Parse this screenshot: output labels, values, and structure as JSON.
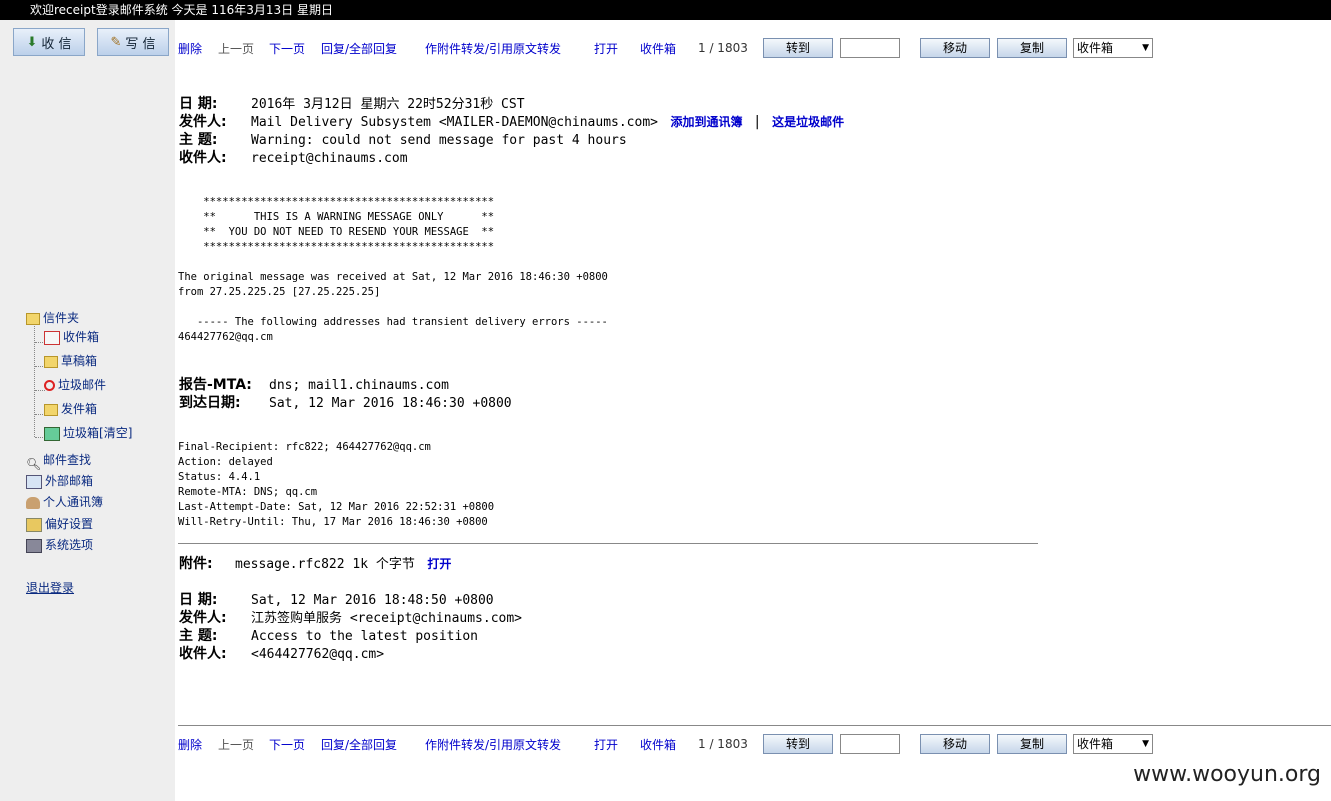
{
  "topbar": {
    "text": "欢迎receipt登录邮件系统  今天是  116年3月13日  星期日"
  },
  "sidebar": {
    "btn_receive": "收 信",
    "btn_compose": "写 信",
    "folders_label": "信件夹",
    "inbox": "收件箱",
    "drafts": "草稿箱",
    "spam": "垃圾邮件",
    "sent": "发件箱",
    "trash": "垃圾箱",
    "trash_empty": "[清空]",
    "search": "邮件查找",
    "external": "外部邮箱",
    "contacts": "个人通讯簿",
    "prefs": "偏好设置",
    "sysopts": "系统选项",
    "logout": "退出登录"
  },
  "toolbar": {
    "delete": "删除",
    "prev": "上一页",
    "next": "下一页",
    "reply": "回复/全部回复",
    "forward": "作附件转发/引用原文转发",
    "open": "打开",
    "folder_link": "收件箱",
    "pager": "1 / 1803",
    "goto": "转到",
    "move": "移动",
    "copy": "复制",
    "select_value": "收件箱"
  },
  "message": {
    "date_label": "日  期:",
    "date": "2016年 3月12日 星期六 22时52分31秒 CST",
    "from_label": "发件人:",
    "from": "Mail Delivery Subsystem <MAILER-DAEMON@chinaums.com>",
    "add_contact": "添加到通讯簿",
    "mark_spam": "这是垃圾邮件",
    "subject_label": "主  题:",
    "subject": "Warning: could not send message for past 4 hours",
    "to_label": "收件人:",
    "to": "receipt@chinaums.com",
    "body1": "    **********************************************\n    **      THIS IS A WARNING MESSAGE ONLY      **\n    **  YOU DO NOT NEED TO RESEND YOUR MESSAGE  **\n    **********************************************",
    "body2": "The original message was received at Sat, 12 Mar 2016 18:46:30 +0800\nfrom 27.25.225.25 [27.25.225.25]",
    "body3": "   ----- The following addresses had transient delivery errors -----\n464427762@qq.cm",
    "mta_label": "报告-MTA:",
    "mta": "dns; mail1.chinaums.com",
    "arrival_label": "到达日期:",
    "arrival": "Sat, 12 Mar 2016 18:46:30 +0800",
    "body4": "Final-Recipient: rfc822; 464427762@qq.cm\nAction: delayed\nStatus: 4.4.1\nRemote-MTA: DNS; qq.cm\nLast-Attempt-Date: Sat, 12 Mar 2016 22:52:31 +0800\nWill-Retry-Until: Thu, 17 Mar 2016 18:46:30 +0800",
    "attach_label": "附件:",
    "attach": "message.rfc822 1k 个字节",
    "attach_open": "打开"
  },
  "original": {
    "date_label": "日  期:",
    "date": "Sat, 12 Mar 2016 18:48:50 +0800",
    "from_label": "发件人:",
    "from": "江苏签购单服务 <receipt@chinaums.com>",
    "subject_label": "主  题:",
    "subject": "Access to the latest position",
    "to_label": "收件人:",
    "to": "<464427762@qq.cm>"
  },
  "watermark": "www.wooyun.org"
}
